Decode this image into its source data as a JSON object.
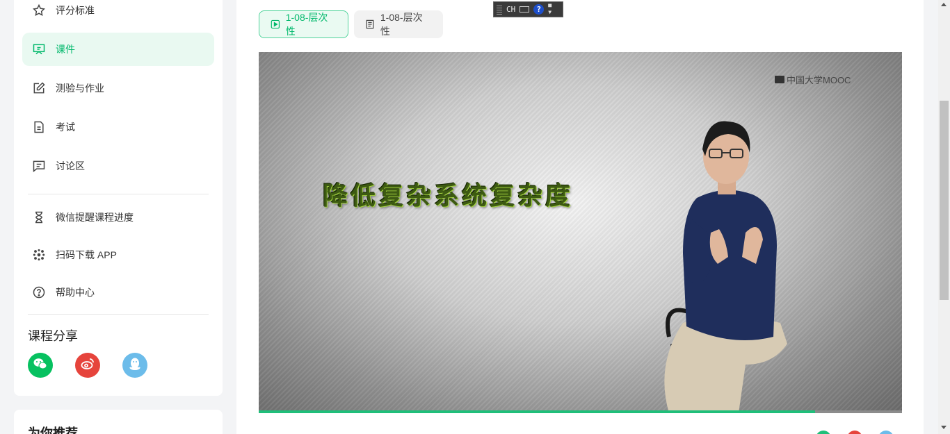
{
  "sidebar": {
    "items": [
      {
        "label": "评分标准",
        "icon": "star-icon",
        "active": false
      },
      {
        "label": "课件",
        "icon": "presentation-icon",
        "active": true
      },
      {
        "label": "测验与作业",
        "icon": "edit-icon",
        "active": false
      },
      {
        "label": "考试",
        "icon": "document-icon",
        "active": false
      },
      {
        "label": "讨论区",
        "icon": "chat-icon",
        "active": false
      }
    ],
    "extra_items": [
      {
        "label": "微信提醒课程进度",
        "icon": "hourglass-icon"
      },
      {
        "label": "扫码下载 APP",
        "icon": "qrcode-icon"
      },
      {
        "label": "帮助中心",
        "icon": "help-icon"
      }
    ],
    "share": {
      "title": "课程分享",
      "icons": [
        "wechat-icon",
        "weibo-icon",
        "qq-icon"
      ]
    },
    "recommend_title": "为你推荐"
  },
  "tabs": [
    {
      "label": "1-08-层次性",
      "icon": "play-icon",
      "active": true
    },
    {
      "label": "1-08-层次性",
      "icon": "document-icon",
      "active": false
    }
  ],
  "video": {
    "title_text": "降低复杂系统复杂度",
    "watermark": "中国大学MOOC",
    "progress": 0.865
  },
  "ime": {
    "mode": "CH",
    "help": "?"
  },
  "colors": {
    "accent": "#00b86b",
    "wechat": "#07c160",
    "weibo": "#e6443c",
    "qq": "#6cbcea"
  }
}
